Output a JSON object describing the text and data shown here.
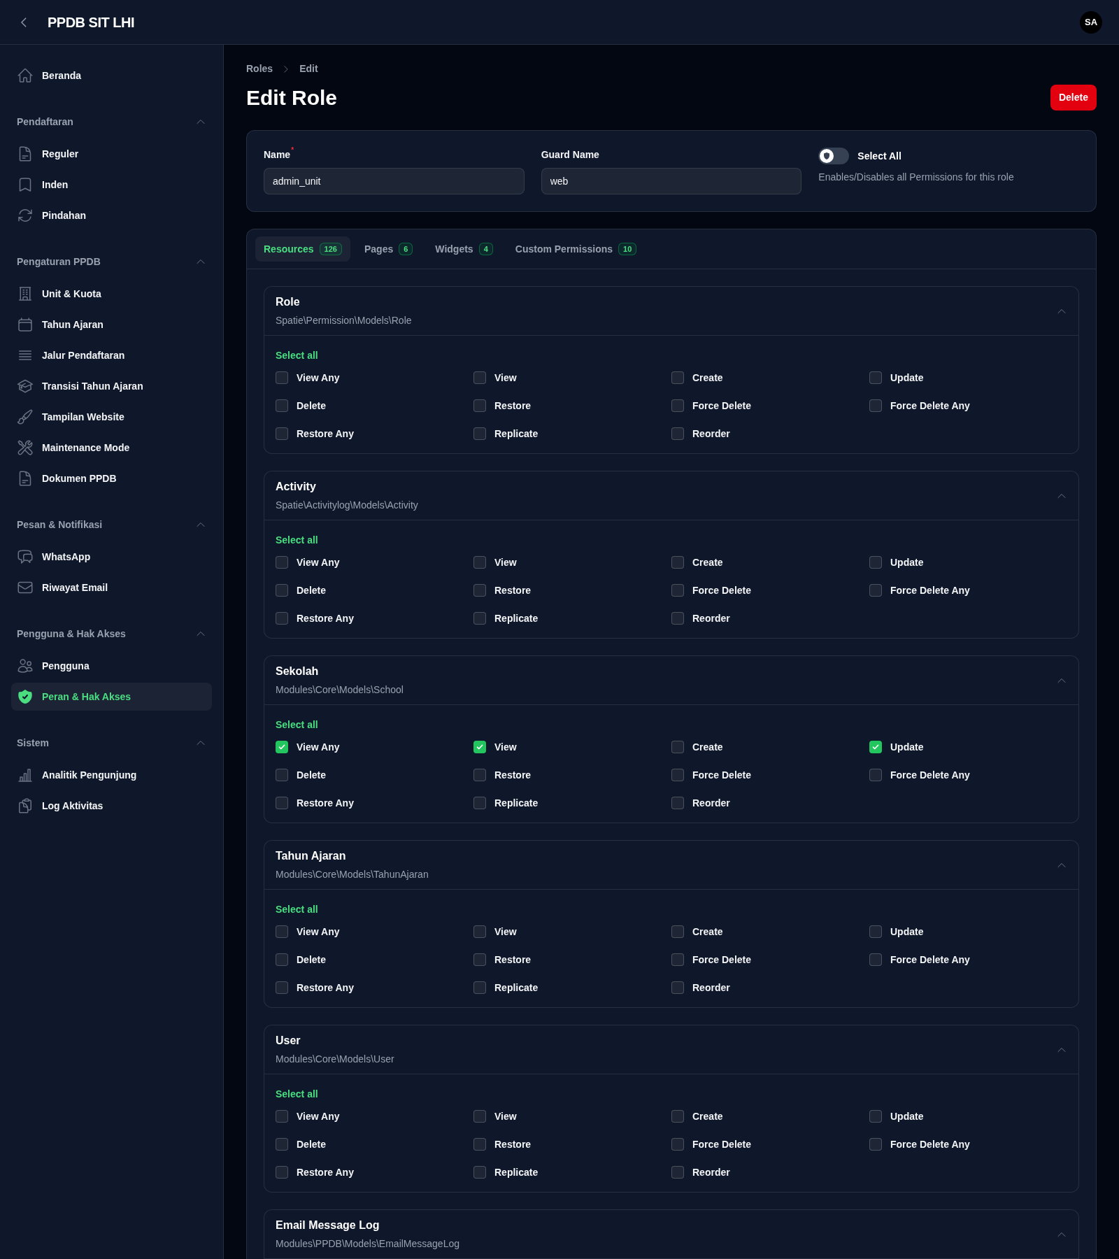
{
  "topbar": {
    "title": "PPDB SIT LHI",
    "avatar": "SA"
  },
  "sidebar": {
    "items": [
      {
        "label": "Beranda",
        "selected": false
      }
    ],
    "groups": [
      {
        "label": "Pendaftaran",
        "expanded": true,
        "items": [
          {
            "label": "Reguler",
            "selected": false
          },
          {
            "label": "Inden",
            "selected": false
          },
          {
            "label": "Pindahan",
            "selected": false
          }
        ]
      },
      {
        "label": "Pengaturan PPDB",
        "expanded": true,
        "items": [
          {
            "label": "Unit & Kuota",
            "selected": false
          },
          {
            "label": "Tahun Ajaran",
            "selected": false
          },
          {
            "label": "Jalur Pendaftaran",
            "selected": false
          },
          {
            "label": "Transisi Tahun Ajaran",
            "selected": false
          },
          {
            "label": "Tampilan Website",
            "selected": false
          },
          {
            "label": "Maintenance Mode",
            "selected": false
          },
          {
            "label": "Dokumen PPDB",
            "selected": false
          }
        ]
      },
      {
        "label": "Pesan & Notifikasi",
        "expanded": true,
        "items": [
          {
            "label": "WhatsApp",
            "selected": false
          },
          {
            "label": "Riwayat Email",
            "selected": false
          }
        ]
      },
      {
        "label": "Pengguna & Hak Akses",
        "expanded": true,
        "items": [
          {
            "label": "Pengguna",
            "selected": false
          },
          {
            "label": "Peran & Hak Akses",
            "selected": true
          }
        ]
      },
      {
        "label": "Sistem",
        "expanded": true,
        "items": [
          {
            "label": "Analitik Pengunjung",
            "selected": false
          },
          {
            "label": "Log Aktivitas",
            "selected": false
          }
        ]
      }
    ]
  },
  "breadcrumb": [
    "Roles",
    "Edit"
  ],
  "page_title": "Edit Role",
  "delete_button": "Delete",
  "form": {
    "name": {
      "label": "Name",
      "required_mark": "*",
      "value": "admin_unit"
    },
    "guard_name": {
      "label": "Guard Name",
      "value": "web"
    },
    "select_all": {
      "label": "Select All",
      "on": false,
      "hint": "Enables/Disables all Permissions for this role"
    }
  },
  "tabs": [
    {
      "label": "Resources",
      "count": "126",
      "selected": true
    },
    {
      "label": "Pages",
      "count": "6",
      "selected": false
    },
    {
      "label": "Widgets",
      "count": "4",
      "selected": false
    },
    {
      "label": "Custom Permissions",
      "count": "10",
      "selected": false
    }
  ],
  "resources": [
    {
      "title": "Role",
      "model": "Spatie\\Permission\\Models\\Role",
      "expanded": true,
      "select_all": "Select all",
      "permissions": [
        {
          "label": "View Any",
          "checked": false
        },
        {
          "label": "View",
          "checked": false
        },
        {
          "label": "Create",
          "checked": false
        },
        {
          "label": "Update",
          "checked": false
        },
        {
          "label": "Delete",
          "checked": false
        },
        {
          "label": "Restore",
          "checked": false
        },
        {
          "label": "Force Delete",
          "checked": false
        },
        {
          "label": "Force Delete Any",
          "checked": false
        },
        {
          "label": "Restore Any",
          "checked": false
        },
        {
          "label": "Replicate",
          "checked": false
        },
        {
          "label": "Reorder",
          "checked": false
        }
      ]
    },
    {
      "title": "Activity",
      "model": "Spatie\\Activitylog\\Models\\Activity",
      "expanded": true,
      "select_all": "Select all",
      "permissions": [
        {
          "label": "View Any",
          "checked": false
        },
        {
          "label": "View",
          "checked": false
        },
        {
          "label": "Create",
          "checked": false
        },
        {
          "label": "Update",
          "checked": false
        },
        {
          "label": "Delete",
          "checked": false
        },
        {
          "label": "Restore",
          "checked": false
        },
        {
          "label": "Force Delete",
          "checked": false
        },
        {
          "label": "Force Delete Any",
          "checked": false
        },
        {
          "label": "Restore Any",
          "checked": false
        },
        {
          "label": "Replicate",
          "checked": false
        },
        {
          "label": "Reorder",
          "checked": false
        }
      ]
    },
    {
      "title": "Sekolah",
      "model": "Modules\\Core\\Models\\School",
      "expanded": true,
      "select_all": "Select all",
      "permissions": [
        {
          "label": "View Any",
          "checked": true
        },
        {
          "label": "View",
          "checked": true
        },
        {
          "label": "Create",
          "checked": false
        },
        {
          "label": "Update",
          "checked": true
        },
        {
          "label": "Delete",
          "checked": false
        },
        {
          "label": "Restore",
          "checked": false
        },
        {
          "label": "Force Delete",
          "checked": false
        },
        {
          "label": "Force Delete Any",
          "checked": false
        },
        {
          "label": "Restore Any",
          "checked": false
        },
        {
          "label": "Replicate",
          "checked": false
        },
        {
          "label": "Reorder",
          "checked": false
        }
      ]
    },
    {
      "title": "Tahun Ajaran",
      "model": "Modules\\Core\\Models\\TahunAjaran",
      "expanded": true,
      "select_all": "Select all",
      "permissions": [
        {
          "label": "View Any",
          "checked": false
        },
        {
          "label": "View",
          "checked": false
        },
        {
          "label": "Create",
          "checked": false
        },
        {
          "label": "Update",
          "checked": false
        },
        {
          "label": "Delete",
          "checked": false
        },
        {
          "label": "Restore",
          "checked": false
        },
        {
          "label": "Force Delete",
          "checked": false
        },
        {
          "label": "Force Delete Any",
          "checked": false
        },
        {
          "label": "Restore Any",
          "checked": false
        },
        {
          "label": "Replicate",
          "checked": false
        },
        {
          "label": "Reorder",
          "checked": false
        }
      ]
    },
    {
      "title": "User",
      "model": "Modules\\Core\\Models\\User",
      "expanded": true,
      "select_all": "Select all",
      "permissions": [
        {
          "label": "View Any",
          "checked": false
        },
        {
          "label": "View",
          "checked": false
        },
        {
          "label": "Create",
          "checked": false
        },
        {
          "label": "Update",
          "checked": false
        },
        {
          "label": "Delete",
          "checked": false
        },
        {
          "label": "Restore",
          "checked": false
        },
        {
          "label": "Force Delete",
          "checked": false
        },
        {
          "label": "Force Delete Any",
          "checked": false
        },
        {
          "label": "Restore Any",
          "checked": false
        },
        {
          "label": "Replicate",
          "checked": false
        },
        {
          "label": "Reorder",
          "checked": false
        }
      ]
    },
    {
      "title": "Email Message Log",
      "model": "Modules\\PPDB\\Models\\EmailMessageLog",
      "expanded": true
    }
  ]
}
